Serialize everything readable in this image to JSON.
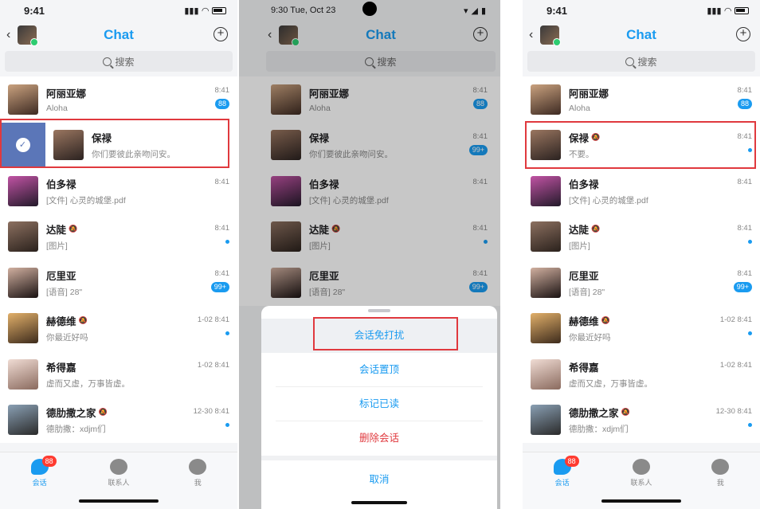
{
  "status": {
    "time_a": "9:41",
    "time_b": "9:30  Tue, Oct 23"
  },
  "nav": {
    "title": "Chat"
  },
  "search": {
    "placeholder": "搜索"
  },
  "chats": [
    {
      "name": "阿丽亚娜",
      "msg": "Aloha",
      "time": "8:41",
      "badge": "88",
      "muted": false,
      "color": "#7b5a48"
    },
    {
      "name": "保禄",
      "msg": "你们要彼此亲吻问安。",
      "time": "8:41",
      "badge": "",
      "muted": false,
      "color": "#5a3d32"
    },
    {
      "name": "伯多禄",
      "msg": "[文件] 心灵的城堡.pdf",
      "time": "8:41",
      "badge": "",
      "muted": false,
      "color": "#3b2a55"
    },
    {
      "name": "达陡",
      "msg": "[图片]",
      "time": "8:41",
      "badge": "",
      "dot": true,
      "muted": true,
      "color": "#5d4639"
    },
    {
      "name": "厄里亚",
      "msg": "[语音] 28\"",
      "time": "8:41",
      "badge": "99+",
      "muted": false,
      "color": "#3a2a2a"
    },
    {
      "name": "赫德维",
      "msg": "你最近好吗",
      "time": "1-02 8:41",
      "badge": "",
      "dot": true,
      "muted": true,
      "color": "#c08a50"
    },
    {
      "name": "希得嘉",
      "msg": "虚而又虚，万事皆虚。",
      "time": "1-02 8:41",
      "badge": "",
      "muted": false,
      "color": "#d8c4bc"
    },
    {
      "name": "德肋撒之家",
      "msg": "德肋撒：xdjm们",
      "time": "12-30 8:41",
      "badge": "",
      "dot": true,
      "muted": true,
      "color": "#4a5d6f"
    }
  ],
  "chat_p2_baolu_badge": "99+",
  "chat_p3_baolu": {
    "name": "保禄",
    "msg": "不要。",
    "time": "8:41"
  },
  "sheet": {
    "items": [
      "会话免打扰",
      "会话置顶",
      "标记已读",
      "删除会话"
    ],
    "cancel": "取消"
  },
  "tabs": [
    {
      "label": "会话",
      "badge": "88"
    },
    {
      "label": "联系人"
    },
    {
      "label": "我"
    }
  ],
  "colors": {
    "accent": "#1a9bf0",
    "danger": "#e0393e",
    "swipe": "#5b76b8"
  }
}
